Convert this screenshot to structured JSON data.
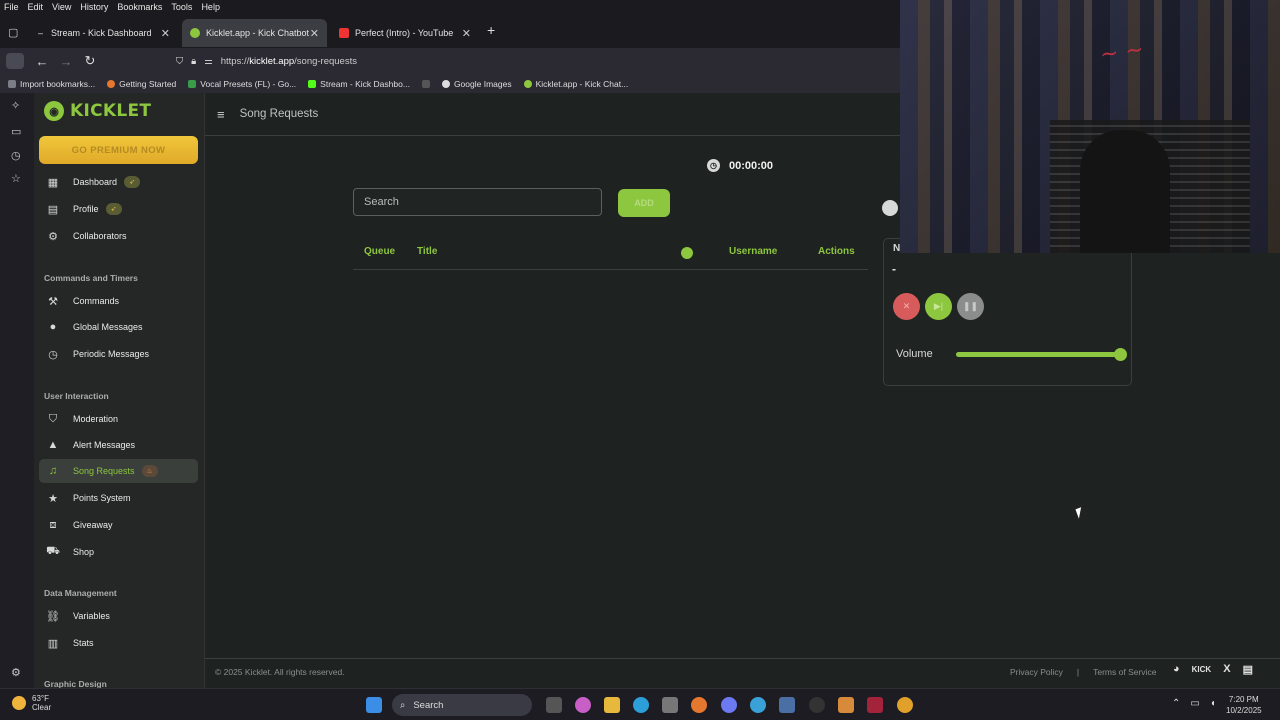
{
  "browser": {
    "menu": [
      "File",
      "Edit",
      "View",
      "History",
      "Bookmarks",
      "Tools",
      "Help"
    ],
    "tabs": [
      {
        "label": "Stream - Kick Dashboard",
        "active": false
      },
      {
        "label": "Kicklet.app - Kick Chatbot and C",
        "active": true
      },
      {
        "label": "Perfect (Intro) - YouTube",
        "active": false
      }
    ],
    "url_prefix": "https://",
    "url_host": "kicklet.app",
    "url_path": "/song-requests",
    "bookmarks": [
      "Import bookmarks...",
      "Getting Started",
      "Vocal Presets (FL) - Go...",
      "Stream - Kick Dashbo...",
      "Google Images",
      "Kicklet.app - Kick Chat..."
    ]
  },
  "sidebar": {
    "logo": "KICKLET",
    "premium": "GO PREMIUM NOW",
    "items": [
      {
        "label": "Dashboard",
        "icon": "dashboard-icon",
        "glyph": "▦",
        "badge": "🚀"
      },
      {
        "label": "Profile",
        "icon": "profile-icon",
        "glyph": "▤",
        "badge": "🚀"
      },
      {
        "label": "Collaborators",
        "icon": "collaborators-icon",
        "glyph": "⚙"
      }
    ],
    "sections": [
      {
        "title": "Commands and Timers",
        "items": [
          {
            "label": "Commands",
            "icon": "hammer-icon",
            "glyph": "⚒"
          },
          {
            "label": "Global Messages",
            "icon": "chat-bubble-icon",
            "glyph": "●"
          },
          {
            "label": "Periodic Messages",
            "icon": "clock-icon",
            "glyph": "◷"
          }
        ]
      },
      {
        "title": "User Interaction",
        "items": [
          {
            "label": "Moderation",
            "icon": "shield-icon",
            "glyph": "⛉"
          },
          {
            "label": "Alert Messages",
            "icon": "warning-icon",
            "glyph": "▲"
          },
          {
            "label": "Song Requests",
            "icon": "music-note-icon",
            "glyph": "♫",
            "badge": "🔥",
            "active": true
          },
          {
            "label": "Points System",
            "icon": "star-icon",
            "glyph": "★"
          },
          {
            "label": "Giveaway",
            "icon": "gift-icon",
            "glyph": "⧈"
          },
          {
            "label": "Shop",
            "icon": "cart-icon",
            "glyph": "⛟"
          }
        ]
      },
      {
        "title": "Data Management",
        "items": [
          {
            "label": "Variables",
            "icon": "link-icon",
            "glyph": "⛓"
          },
          {
            "label": "Stats",
            "icon": "bar-chart-icon",
            "glyph": "▥"
          }
        ]
      },
      {
        "title": "Graphic Design",
        "items": []
      }
    ]
  },
  "main": {
    "page_title": "Song Requests",
    "timer": "00:00:00",
    "search_placeholder": "Search",
    "add_label": "ADD",
    "columns": {
      "queue": "Queue",
      "title": "Title",
      "username": "Username",
      "actions": "Actions"
    },
    "player": {
      "now_label": "N",
      "current": "-",
      "volume_label": "Volume",
      "volume_level": 1.0
    },
    "footer": {
      "copyright": "© 2025 Kicklet. All rights reserved.",
      "privacy": "Privacy Policy",
      "separator": "|",
      "terms": "Terms of Service",
      "socials": [
        "discord-icon",
        "kick-icon",
        "x-icon",
        "docs-icon"
      ],
      "kick_text": "KICK",
      "x_text": "X"
    }
  },
  "taskbar": {
    "temp": "63°F",
    "condition": "Clear",
    "search": "Search",
    "time": "7:20 PM",
    "date": "10/2/2025"
  },
  "colors": {
    "accent": "#8dc63f",
    "premium": "#e0a929",
    "danger": "#d85b5b"
  }
}
